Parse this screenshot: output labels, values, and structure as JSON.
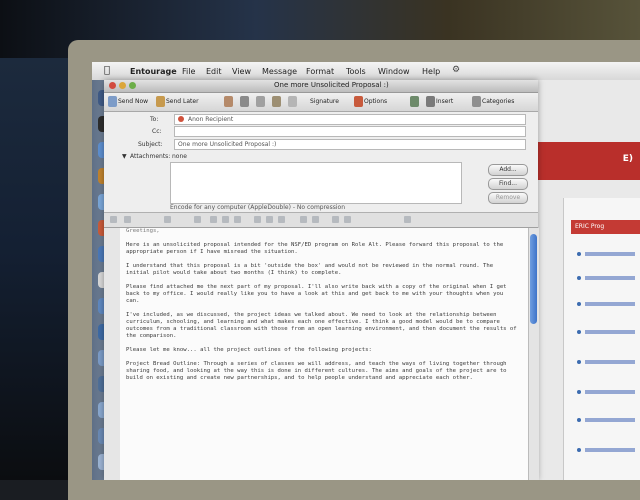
{
  "window": {
    "title": "One more Unsolicited Proposal :)"
  },
  "menubar": {
    "app": "Entourage",
    "items": [
      "File",
      "Edit",
      "View",
      "Message",
      "Format",
      "Tools",
      "Window",
      "Help"
    ]
  },
  "toolbar": {
    "send_now": "Send Now",
    "send_later": "Send Later",
    "signature": "Signature",
    "options": "Options",
    "insert": "Insert",
    "categories": "Categories"
  },
  "header": {
    "to_label": "To:",
    "cc_label": "Cc:",
    "to_value": "Anon Recipient",
    "subject_label": "Subject:",
    "subject_value": "One more Unsolicited Proposal :)",
    "attachments_label": "Attachments:",
    "attachments_value": "none",
    "encode_note": "Encode for any computer (AppleDouble) - No compression",
    "add_button": "Add...",
    "find_button": "Find...",
    "remove_button": "Remove"
  },
  "body": {
    "paragraphs": [
      "Greetings,",
      "Here is an unsolicited proposal intended for the NSF/ED program on Role Alt. Please forward this proposal to the appropriate person if I have misread the situation.",
      "I understand that this proposal is a bit 'outside the box' and would not be reviewed in the normal round. The initial pilot would take about two months (I think) to complete.",
      "Please find attached me the next part of my proposal. I'll also write back with a copy of the original when I get back to my office. I would really like you to have a look at this and get back to me with your thoughts when you can.",
      "I've included, as we discussed, the project ideas we talked about. We need to look at the relationship between curriculum, schooling, and learning and what makes each one effective. I think a good model would be to compare outcomes from a traditional classroom with those from an open learning environment, and then document the results of the comparison.",
      "Please let me know... all the project outlines of the following projects:",
      "Project Bread Outline: Through a series of classes we will address, and teach the ways of living together through sharing food, and looking at the way this is done in different cultures. The aims and goals of the project are to build on existing and create new partnerships, and to help people understand and appreciate each other."
    ]
  },
  "background_window": {
    "banner_text": "E)",
    "sidebar_heading": "ERIC Prog"
  }
}
